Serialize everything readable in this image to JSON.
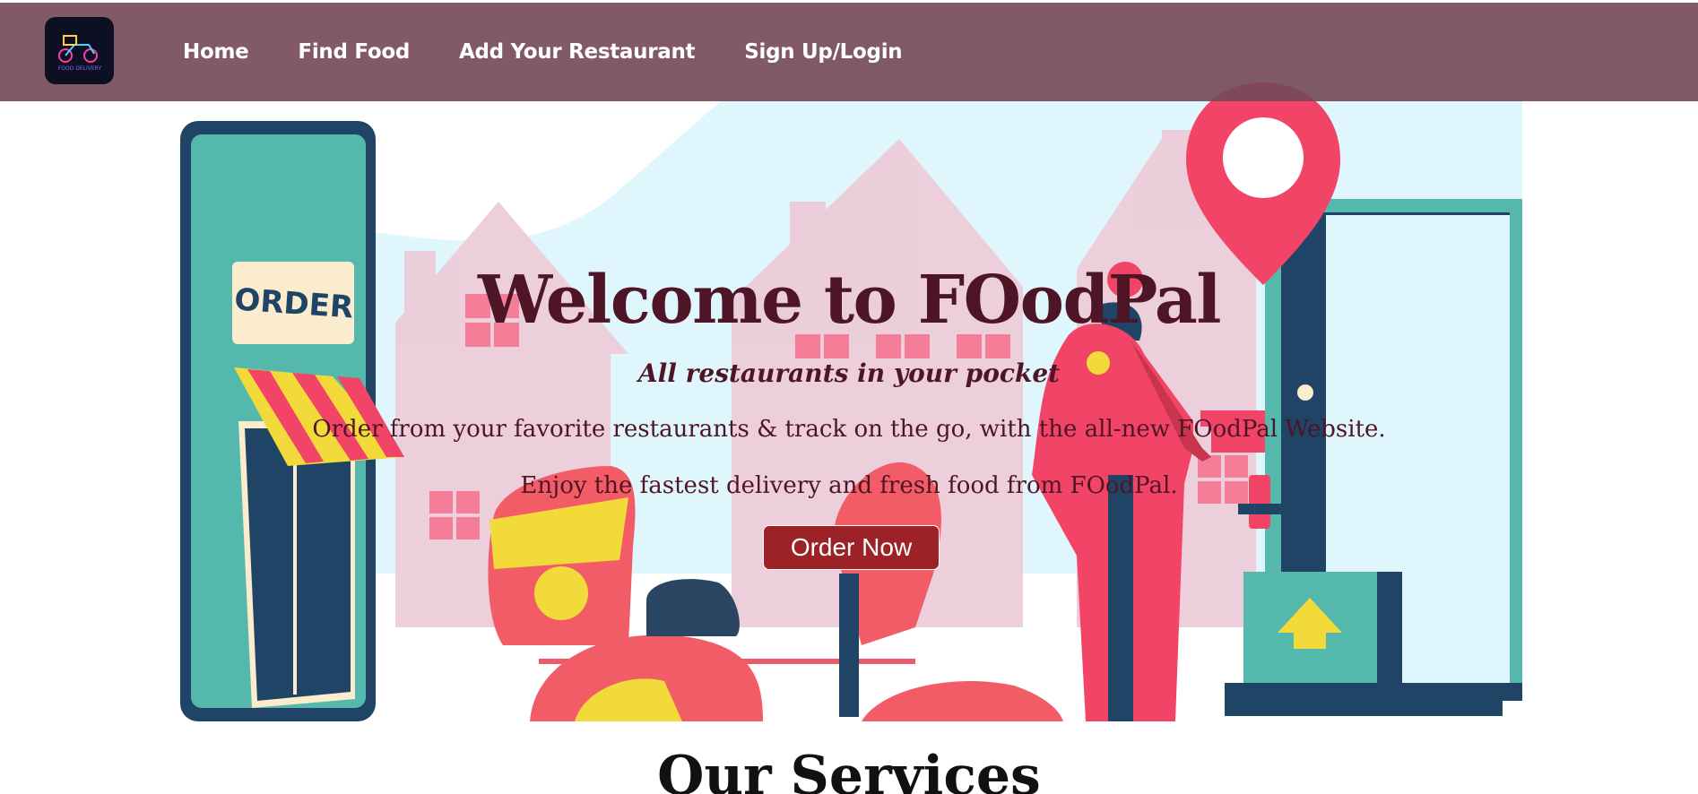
{
  "brand": {
    "logo_text": "FOOD DELIVERY"
  },
  "nav": {
    "items": [
      {
        "label": "Home"
      },
      {
        "label": "Find Food"
      },
      {
        "label": "Add Your Restaurant"
      },
      {
        "label": "Sign Up/Login"
      }
    ]
  },
  "hero": {
    "title": "Welcome to FOodPal",
    "tagline": "All restaurants in your pocket",
    "description_1": "Order from your favorite restaurants & track on the go, with the all-new FOodPal Website.",
    "description_2": "Enjoy the fastest delivery and fresh food from FOodPal.",
    "cta_label": "Order Now",
    "illustration": {
      "phone_sign_text": "ORDER"
    }
  },
  "services": {
    "title": "Our Services"
  },
  "colors": {
    "navbar": "#764858",
    "title_text": "#4e1526",
    "cta_button": "#9c2228",
    "accent_pink": "#f24466",
    "accent_teal": "#54b9ac",
    "accent_navy": "#1f4466",
    "sky": "#dff6fd"
  }
}
